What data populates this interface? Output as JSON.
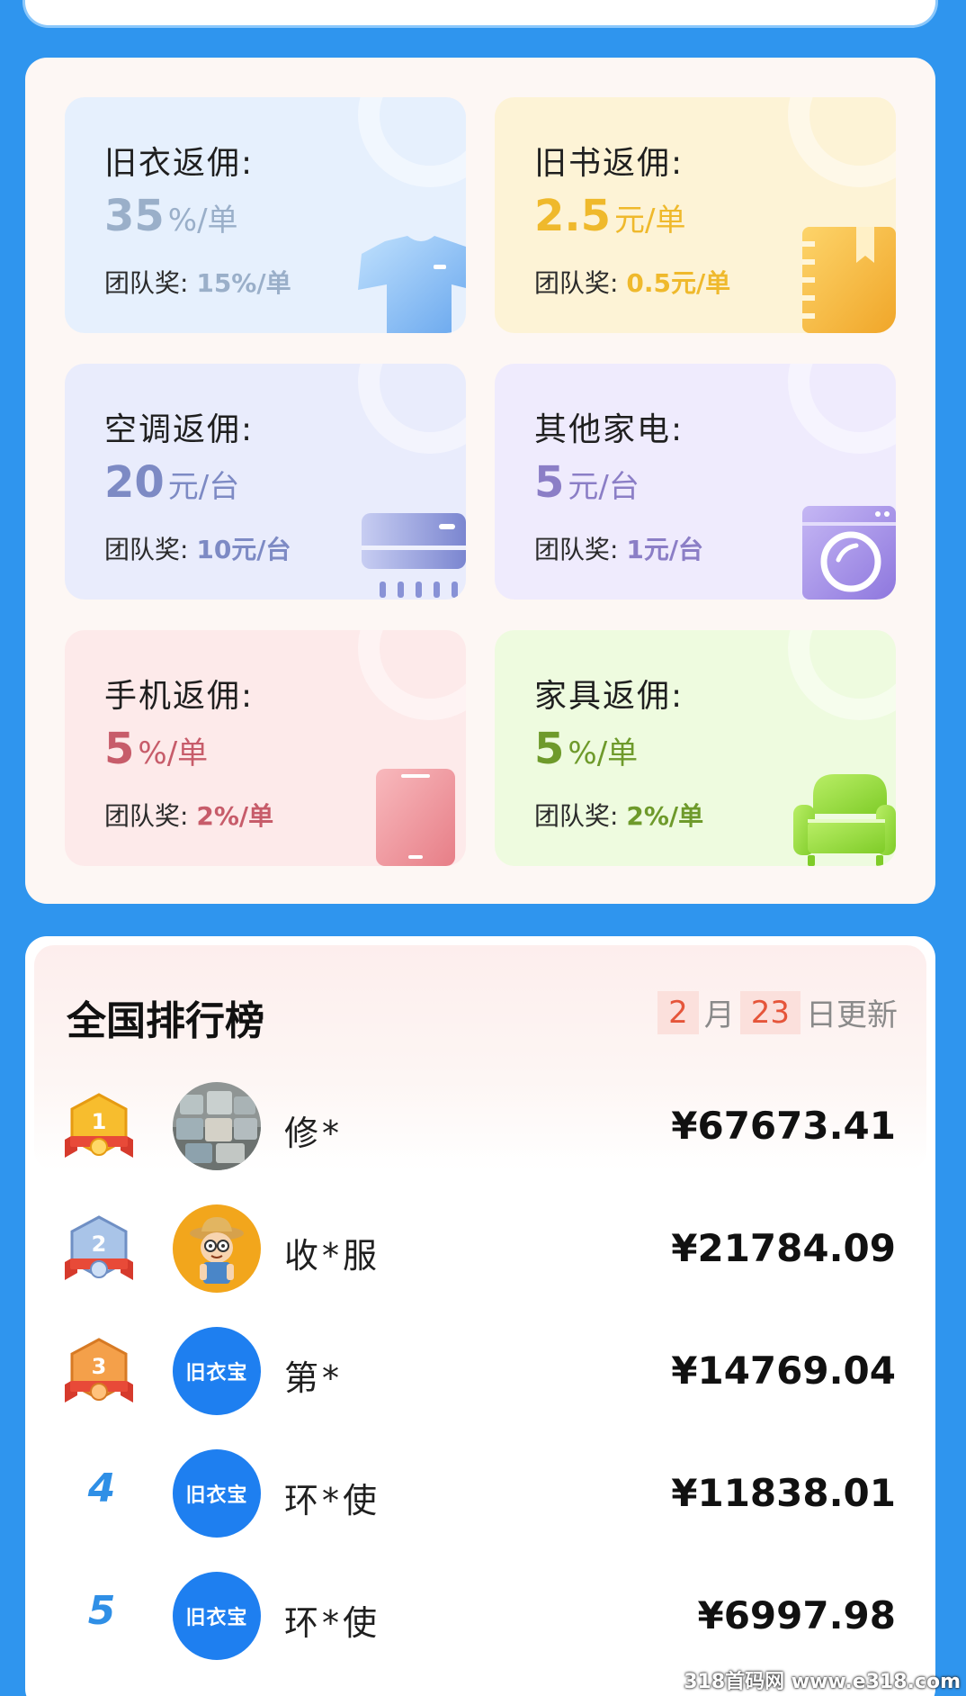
{
  "commission_cards": [
    {
      "title": "旧衣返佣:",
      "rate_value": "35",
      "rate_unit": "%/单",
      "team_label": "团队奖:",
      "team_value": "15%/单",
      "accent": "#9aafc9",
      "bg": "#e6f0fd",
      "icon": "tshirt-icon"
    },
    {
      "title": "旧书返佣:",
      "rate_value": "2.5",
      "rate_unit": "元/单",
      "team_label": "团队奖:",
      "team_value": "0.5元/单",
      "accent": "#efb92c",
      "bg": "#fdf3d6",
      "icon": "book-icon"
    },
    {
      "title": "空调返佣:",
      "rate_value": "20",
      "rate_unit": "元/台",
      "team_label": "团队奖:",
      "team_value": "10元/台",
      "accent": "#7d8ac4",
      "bg": "#e9ecfc",
      "icon": "air-conditioner-icon"
    },
    {
      "title": "其他家电:",
      "rate_value": "5",
      "rate_unit": "元/台",
      "team_label": "团队奖:",
      "team_value": "1元/台",
      "accent": "#8b7ec6",
      "bg": "#efebfd",
      "icon": "washing-machine-icon"
    },
    {
      "title": "手机返佣:",
      "rate_value": "5",
      "rate_unit": "%/单",
      "team_label": "团队奖:",
      "team_value": "2%/单",
      "accent": "#c75c6a",
      "bg": "#fdeaea",
      "icon": "phone-icon"
    },
    {
      "title": "家具返佣:",
      "rate_value": "5",
      "rate_unit": "%/单",
      "team_label": "团队奖:",
      "team_value": "2%/单",
      "accent": "#6e9a2b",
      "bg": "#eefbdf",
      "icon": "sofa-icon"
    }
  ],
  "ranking": {
    "title": "全国排行榜",
    "update_month": "2",
    "month_label": "月",
    "update_day": "23",
    "update_suffix": "日更新",
    "rows": [
      {
        "rank": "1",
        "name": "修*",
        "amount": "¥67673.41",
        "avatar": "photo-avatar"
      },
      {
        "rank": "2",
        "name": "收*服",
        "amount": "¥21784.09",
        "avatar": "farmer-avatar"
      },
      {
        "rank": "3",
        "name": "第*",
        "amount": "¥14769.04",
        "avatar": "brand-avatar",
        "avatar_text": "旧衣宝"
      },
      {
        "rank": "4",
        "name": "环*使",
        "amount": "¥11838.01",
        "avatar": "brand-avatar",
        "avatar_text": "旧衣宝"
      },
      {
        "rank": "5",
        "name": "环*使",
        "amount": "¥6997.98",
        "avatar": "brand-avatar",
        "avatar_text": "旧衣宝"
      }
    ]
  },
  "watermark": "318首码网 www.e318.com"
}
